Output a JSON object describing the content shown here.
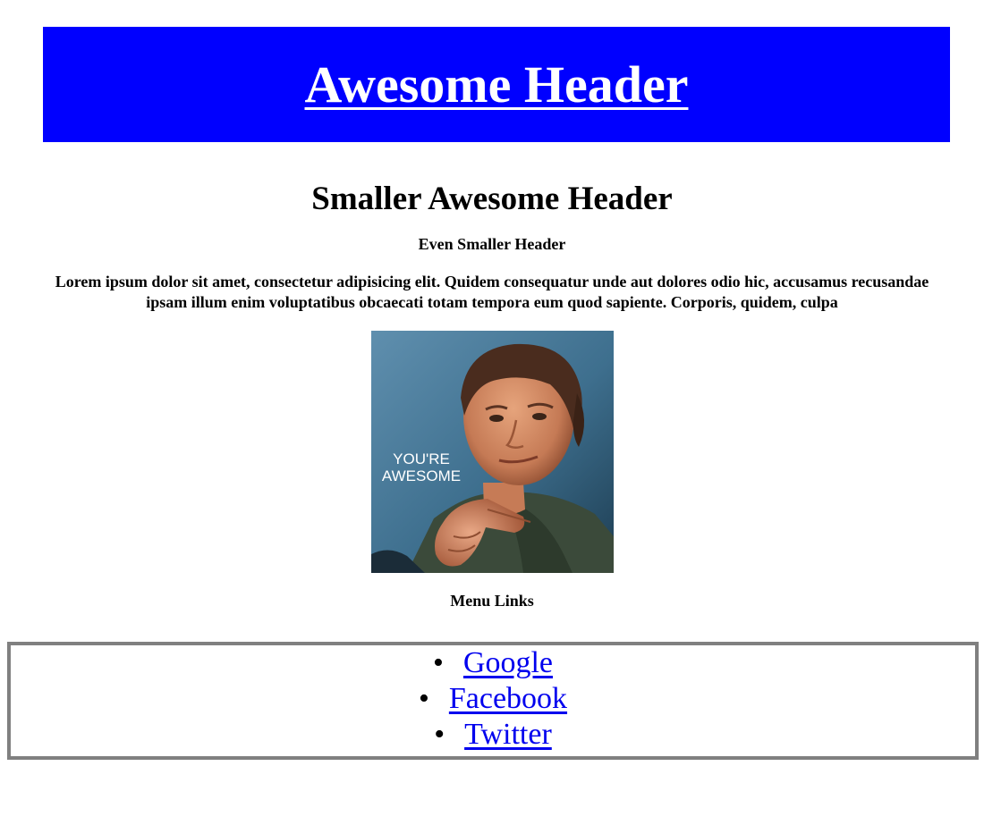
{
  "header": {
    "title": "Awesome Header",
    "background": "#0000ff"
  },
  "content": {
    "subheading": "Smaller Awesome Header",
    "small_heading": "Even Smaller Header",
    "paragraph": "Lorem ipsum dolor sit amet, consectetur adipisicing elit. Quidem consequatur unde aut dolores odio hic, accusamus recusandae ipsam illum enim voluptatibus obcaecati totam tempora eum quod sapiente. Corporis, quidem, culpa",
    "image_caption": "YOU'RE AWESOME",
    "menu_title": "Menu Links"
  },
  "menu": {
    "links": [
      {
        "label": "Google"
      },
      {
        "label": "Facebook"
      },
      {
        "label": "Twitter"
      }
    ],
    "link_color": "#0000ee",
    "border_color": "#808080"
  }
}
